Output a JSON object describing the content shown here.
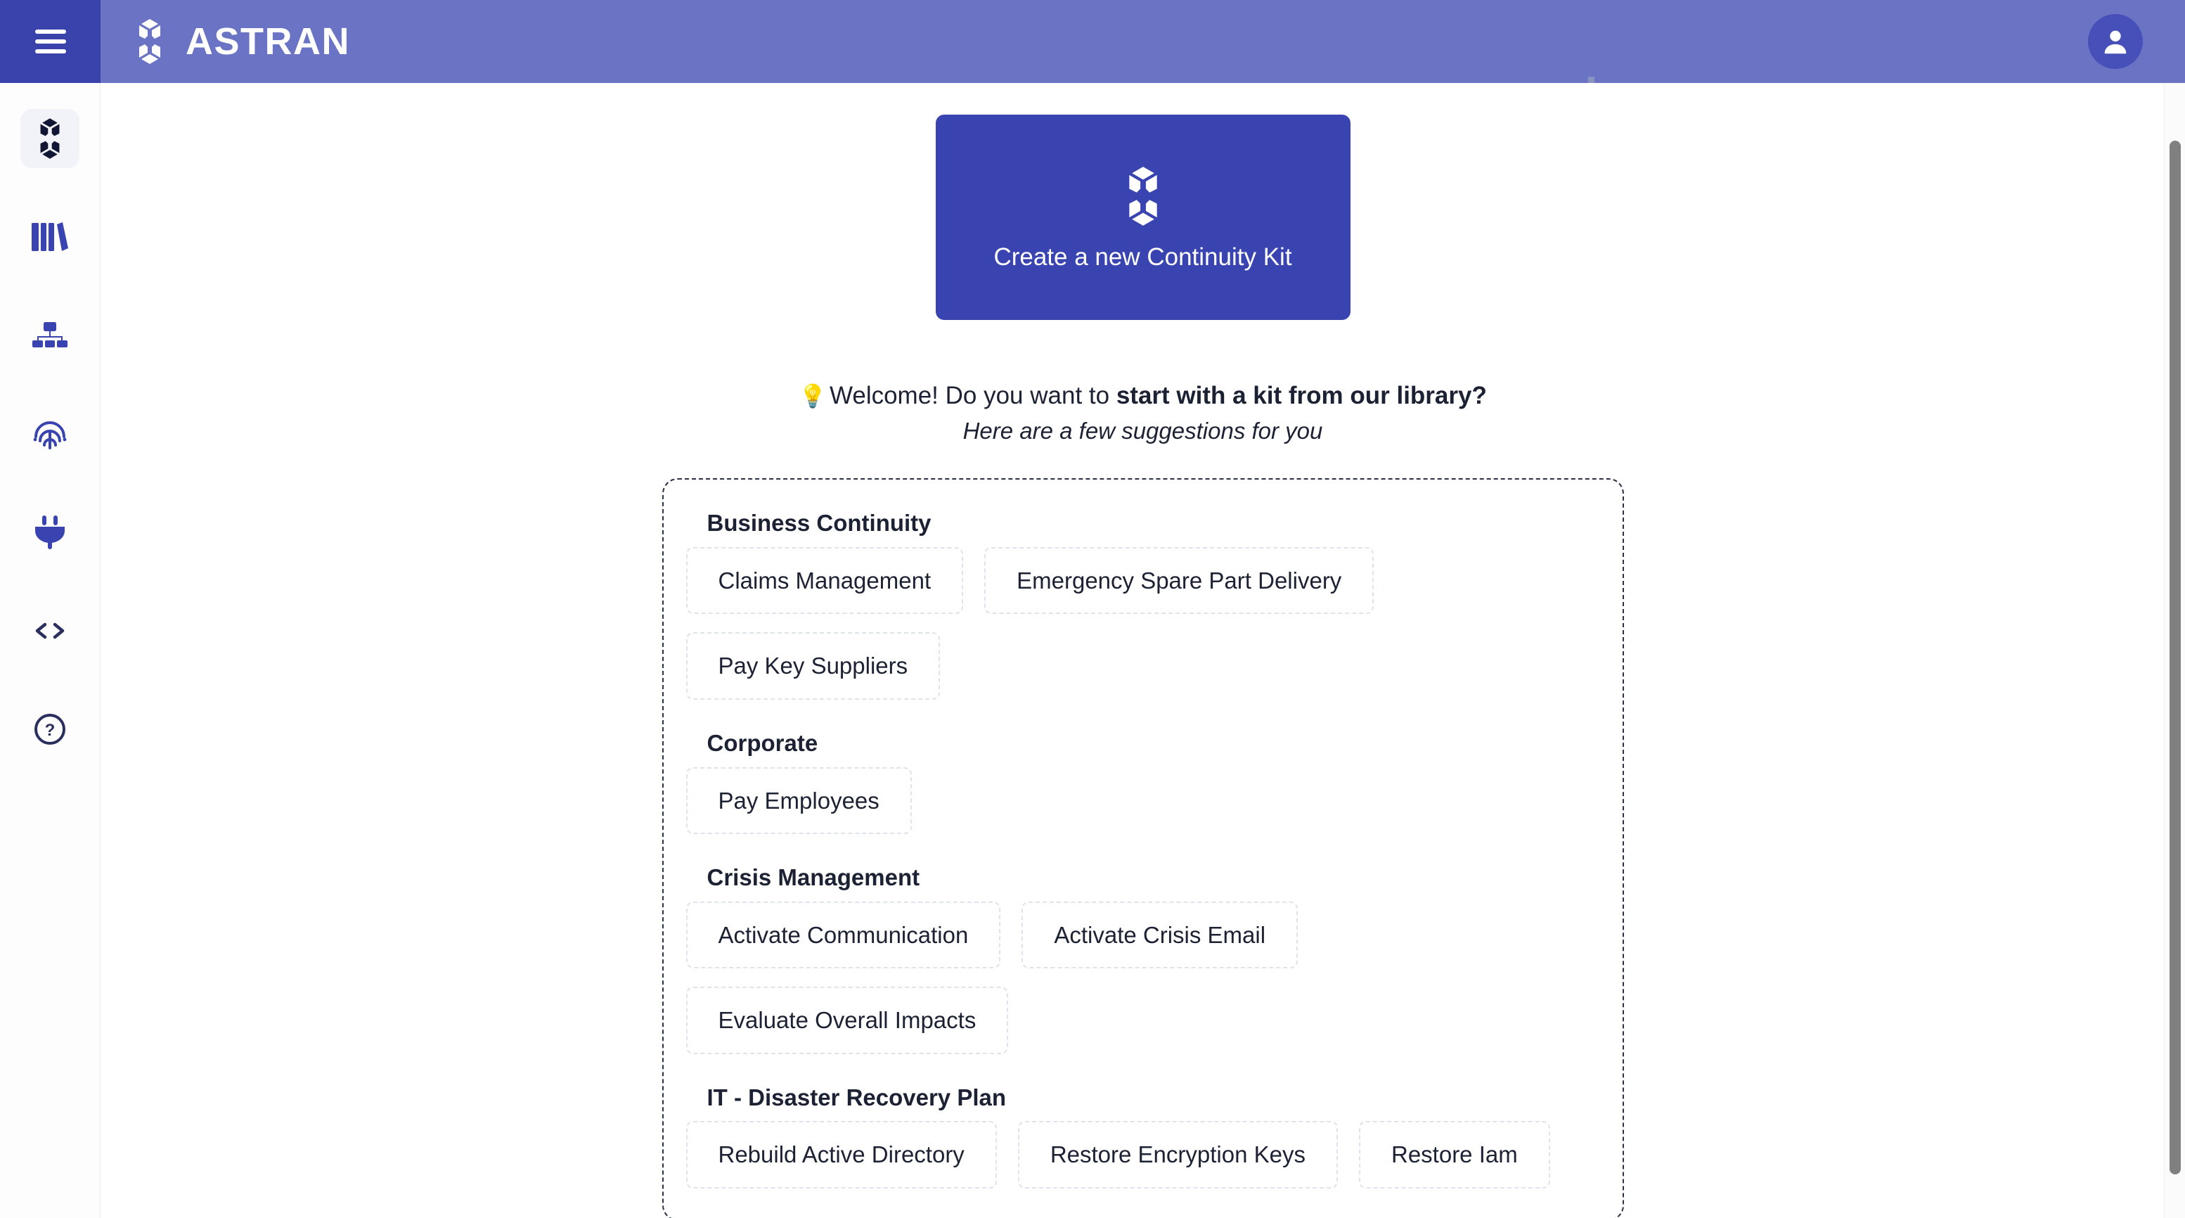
{
  "header": {
    "brand_name": "ASTRAN",
    "menu_icon": "hamburger-icon",
    "logo_icon": "astran-hexagon-logo",
    "avatar_icon": "user-avatar-icon"
  },
  "sidebar": {
    "items": [
      {
        "icon": "astran-hexagon-icon",
        "name": "continuity-kits",
        "active": true
      },
      {
        "icon": "library-books-icon",
        "name": "library",
        "active": false
      },
      {
        "icon": "sitemap-icon",
        "name": "organization",
        "active": false
      },
      {
        "icon": "fingerprint-icon",
        "name": "identity",
        "active": false
      },
      {
        "icon": "plug-icon",
        "name": "connectors",
        "active": false
      },
      {
        "icon": "code-brackets-icon",
        "name": "developers",
        "active": false
      },
      {
        "icon": "help-circle-icon",
        "name": "help",
        "active": false
      }
    ]
  },
  "main": {
    "create_card": {
      "label": "Create a new Continuity Kit",
      "icon": "astran-hexagon-icon",
      "background": "#3a44b0"
    },
    "welcome": {
      "bulb": "💡",
      "text_normal": "Welcome! Do you want to ",
      "text_strong": "start with a kit from our library?",
      "subtitle": "Here are a few suggestions for you"
    },
    "suggestions": [
      {
        "title": "Business Continuity",
        "chips": [
          "Claims Management",
          "Emergency Spare Part Delivery",
          "Pay Key Suppliers"
        ]
      },
      {
        "title": "Corporate",
        "chips": [
          "Pay Employees"
        ]
      },
      {
        "title": "Crisis Management",
        "chips": [
          "Activate Communication",
          "Activate Crisis Email",
          "Evaluate Overall Impacts"
        ]
      },
      {
        "title": "IT - Disaster Recovery Plan",
        "chips": [
          "Rebuild Active Directory",
          "Restore Encryption Keys",
          "Restore Iam"
        ]
      }
    ]
  },
  "colors": {
    "header_bg": "#6b74c4",
    "rail_accent": "#3a43ab",
    "card_blue": "#3a44b0",
    "text_dark": "#1c2233",
    "chip_border": "#dfe3ec"
  }
}
